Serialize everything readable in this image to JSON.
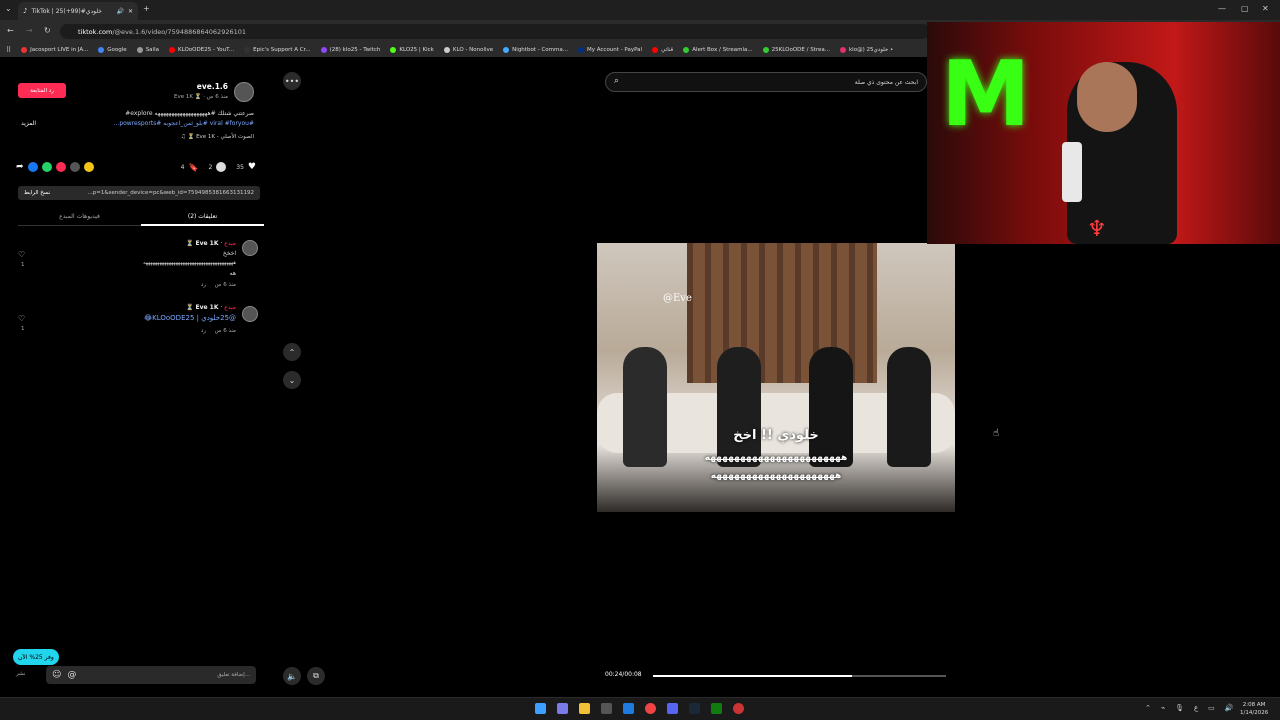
{
  "browser": {
    "tab_title": "TikTok | 25خلودي#(99+)",
    "new_tab": "+",
    "url_host": "tiktok.com",
    "url_path": "/@eve.1.6/video/7594886864062926101",
    "bookmarks": [
      "Jacosport LIVE in JA...",
      "Google",
      "Salla",
      "KLOoODE25 - YouT...",
      "Epic's Support A Cr...",
      "(28) klo25 - Twitch",
      "KLO25 | Kick",
      "KLO - Nonolive",
      "Nightbot - Comma...",
      "My Account - PayPal",
      "قناتي",
      "Alert Box / Streamla...",
      "25KLOoODE / Strea...",
      "klo@) 25خلودي •"
    ]
  },
  "post": {
    "follow_label": "رد المتابعة",
    "username": "eve.1.6",
    "meta": "Eve 1K ⏳ · منذ 6 س",
    "caption": "صرعتني شتلك #هههههههههههههههههههه explore#",
    "hashtags": "#viral #foryou #بلو_ثمن_اعجوبه #powresports...",
    "more_label": "المزيد",
    "sound": "الصوت الأصلي - Eve 1K ⏳ ♫",
    "likes": "35",
    "comments": "2",
    "saves": "4",
    "link_text": "...p=1&sender_device=pc&web_id=7594985381663131192",
    "copy_link": "نسخ الرابط",
    "tab_comments": "تعليقات (2)",
    "tab_creator": "فيديوهات المبدع"
  },
  "comments": [
    {
      "author": "Eve 1K ⏳",
      "badge": "مبدع",
      "lines": [
        "اخخخ",
        "هههههههههههههههههههههههههههههههههههههههه",
        "هه"
      ],
      "time": "منذ 6 س",
      "reply": "رد",
      "likes": "1"
    },
    {
      "author": "Eve 1K ⏳",
      "badge": "مبدع",
      "lines": [
        "@25خلودي | KLOoODE25😂"
      ],
      "time": "منذ 6 س",
      "reply": "رد",
      "likes": "1"
    }
  ],
  "composer": {
    "placeholder": "إضافة تعليق...",
    "post_label": "نشر",
    "mention": "@",
    "emoji": "☺",
    "promo": "وفر 25% الآن"
  },
  "video": {
    "search_placeholder": "ابحث عن محتوى ذي صلة",
    "watermark": "@Eve",
    "subtitle_main": "خلودي !! اخخ",
    "subtitle_l1": "هههههههههههههههههههههههه",
    "subtitle_l2": "هههههههههههههههههههههه",
    "time": "00:24/00:08",
    "progress": 0.68
  },
  "taskbar": {
    "time": "2:08 AM",
    "date": "1/14/2026"
  },
  "colors": {
    "accent": "#fe2c55",
    "link": "#7aa7ff",
    "promo": "#20d5ec"
  }
}
